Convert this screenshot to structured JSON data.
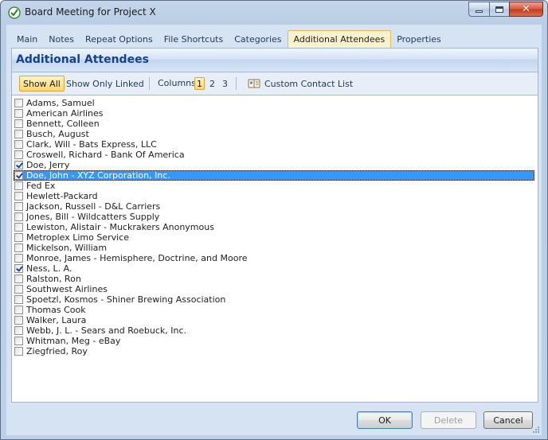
{
  "window": {
    "title": "Board Meeting for Project X",
    "caption_buttons": [
      "minimize-icon",
      "maximize-icon",
      "close-icon"
    ]
  },
  "tabs": [
    {
      "label": "Main",
      "active": false
    },
    {
      "label": "Notes",
      "active": false
    },
    {
      "label": "Repeat Options",
      "active": false
    },
    {
      "label": "File Shortcuts",
      "active": false
    },
    {
      "label": "Categories",
      "active": false
    },
    {
      "label": "Additional Attendees",
      "active": true
    },
    {
      "label": "Properties",
      "active": false
    }
  ],
  "panel": {
    "title": "Additional Attendees"
  },
  "toolbar": {
    "show_all": "Show All",
    "show_only_linked": "Show Only Linked",
    "columns_label": "Columns",
    "columns": [
      "1",
      "2",
      "3"
    ],
    "selected_column": "1",
    "custom_contact_list": "Custom Contact List"
  },
  "attendees": [
    {
      "name": "Adams, Samuel",
      "checked": false
    },
    {
      "name": "American Airlines",
      "checked": false
    },
    {
      "name": "Bennett, Colleen",
      "checked": false
    },
    {
      "name": "Busch, August",
      "checked": false
    },
    {
      "name": "Clark, Will - Bats Express, LLC",
      "checked": false
    },
    {
      "name": "Croswell, Richard - Bank Of America",
      "checked": false
    },
    {
      "name": "Doe, Jerry",
      "checked": true
    },
    {
      "name": "Doe, John - XYZ Corporation, Inc.",
      "checked": true,
      "selected": true
    },
    {
      "name": "Fed Ex",
      "checked": false
    },
    {
      "name": "Hewlett-Packard",
      "checked": false
    },
    {
      "name": "Jackson, Russell - D&L Carriers",
      "checked": false
    },
    {
      "name": "Jones, Bill - Wildcatters Supply",
      "checked": false
    },
    {
      "name": "Lewiston, Alistair - Muckrakers Anonymous",
      "checked": false
    },
    {
      "name": "Metroplex Limo Service",
      "checked": false
    },
    {
      "name": "Mickelson, William",
      "checked": false
    },
    {
      "name": "Monroe, James - Hemisphere, Doctrine, and Moore",
      "checked": false
    },
    {
      "name": "Ness, L. A.",
      "checked": true
    },
    {
      "name": "Ralston, Ron",
      "checked": false
    },
    {
      "name": "Southwest Airlines",
      "checked": false
    },
    {
      "name": "Spoetzl, Kosmos - Shiner Brewing Association",
      "checked": false
    },
    {
      "name": "Thomas Cook",
      "checked": false
    },
    {
      "name": "Walker, Laura",
      "checked": false
    },
    {
      "name": "Webb, J. L. - Sears and Roebuck, Inc.",
      "checked": false
    },
    {
      "name": "Whitman, Meg - eBay",
      "checked": false
    },
    {
      "name": "Ziegfried, Roy",
      "checked": false
    }
  ],
  "footer": {
    "ok": "OK",
    "delete": "Delete",
    "cancel": "Cancel"
  }
}
